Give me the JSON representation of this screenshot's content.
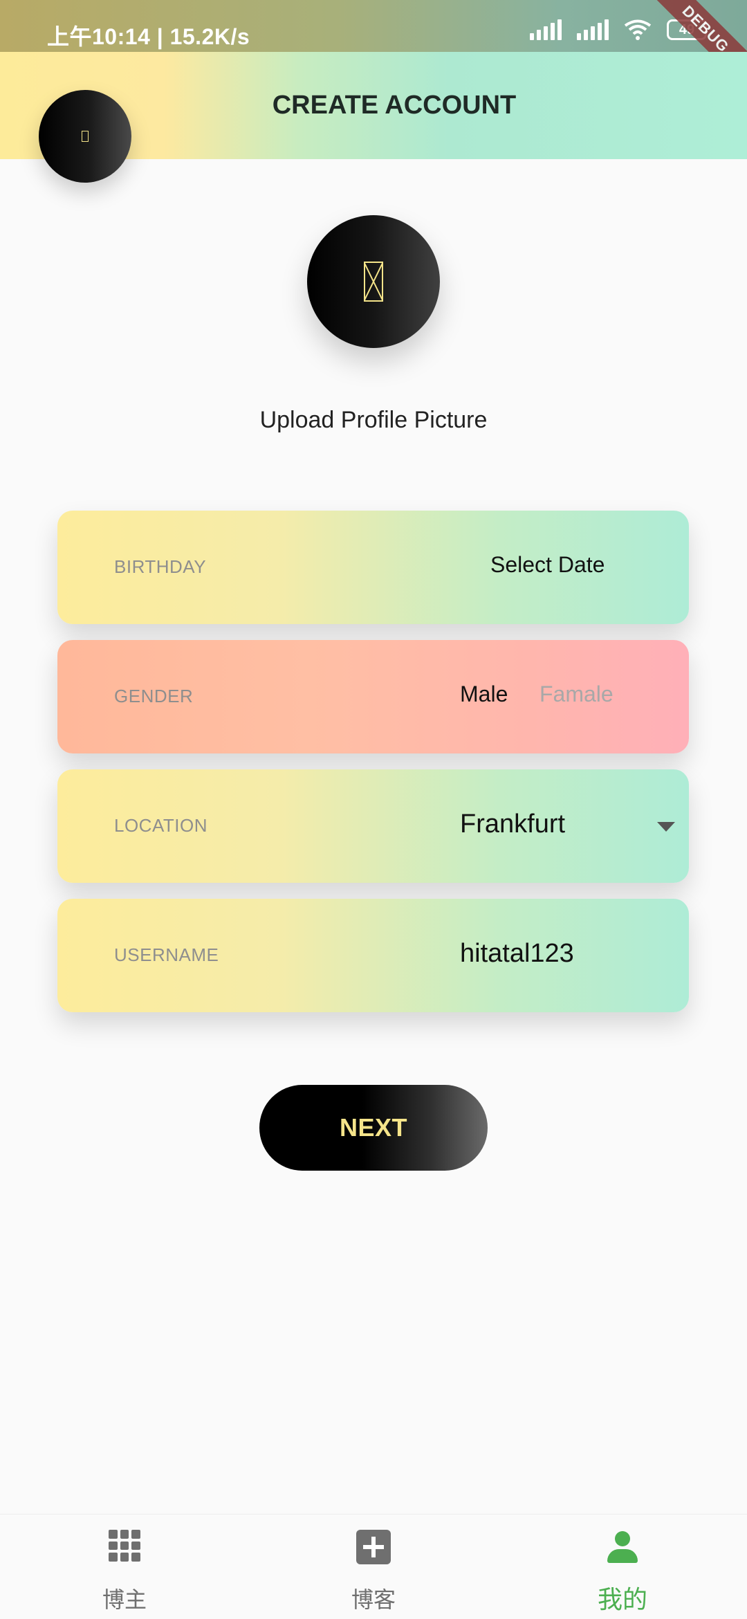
{
  "status_bar": {
    "time_speed": "上午10:14 | 15.2K/s",
    "battery": "49",
    "debug_banner": "DEBUG"
  },
  "app_bar": {
    "title": "CREATE ACCOUNT"
  },
  "profile": {
    "upload_label": "Upload Profile Picture"
  },
  "form": {
    "birthday": {
      "label": "BIRTHDAY",
      "value": "Select Date"
    },
    "gender": {
      "label": "GENDER",
      "option_male": "Male",
      "option_female": "Famale",
      "selected": "Male"
    },
    "location": {
      "label": "LOCATION",
      "value": "Frankfurt"
    },
    "username": {
      "label": "USERNAME",
      "value": "hitatal123"
    }
  },
  "next_button": {
    "label": "NEXT"
  },
  "bottom_nav": {
    "items": [
      {
        "label": "博主",
        "icon": "grid-icon",
        "active": false
      },
      {
        "label": "博客",
        "icon": "add-box-icon",
        "active": false
      },
      {
        "label": "我的",
        "icon": "person-icon",
        "active": true
      }
    ]
  },
  "colors": {
    "accent_yellow": "#f5e48a",
    "mint": "#aeecd6",
    "peach": "#ffb89a",
    "active_nav": "#4caf50"
  }
}
